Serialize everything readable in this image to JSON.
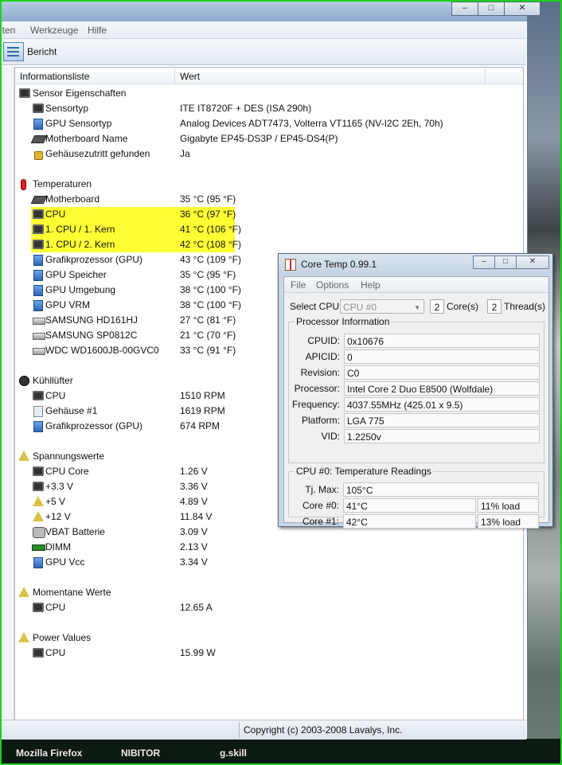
{
  "everest": {
    "menu": [
      "iten",
      "Werkzeuge",
      "Hilfe"
    ],
    "toolbar": {
      "report_label": "Bericht"
    },
    "columns": {
      "name": "Informationsliste",
      "value": "Wert"
    },
    "sections": {
      "sensor": "Sensor Eigenschaften",
      "temps": "Temperaturen",
      "fans": "Kühllüfter",
      "voltages": "Spannungswerte",
      "currents": "Momentane Werte",
      "power": "Power Values"
    },
    "rows": {
      "sensortyp": {
        "name": "Sensortyp",
        "value": "ITE IT8720F + DES  (ISA 290h)"
      },
      "gpu_sensortyp": {
        "name": "GPU Sensortyp",
        "value": "Analog Devices ADT7473, Volterra VT1165  (NV-I2C 2Eh, 70h)"
      },
      "mb_name": {
        "name": "Motherboard Name",
        "value": "Gigabyte EP45-DS3P / EP45-DS4(P)"
      },
      "intrusion": {
        "name": "Gehäusezutritt gefunden",
        "value": "Ja"
      },
      "t_mb": {
        "name": "Motherboard",
        "value": "35 °C  (95 °F)"
      },
      "t_cpu": {
        "name": "CPU",
        "value": "36 °C  (97 °F)"
      },
      "t_core1": {
        "name": "1. CPU / 1. Kern",
        "value": "41 °C  (106 °F)"
      },
      "t_core2": {
        "name": "1. CPU / 2. Kern",
        "value": "42 °C  (108 °F)"
      },
      "t_gpu": {
        "name": "Grafikprozessor (GPU)",
        "value": "43 °C  (109 °F)"
      },
      "t_gpumem": {
        "name": "GPU Speicher",
        "value": "35 °C  (95 °F)"
      },
      "t_gpuamb": {
        "name": "GPU Umgebung",
        "value": "38 °C  (100 °F)"
      },
      "t_gpuvrm": {
        "name": "GPU VRM",
        "value": "38 °C  (100 °F)"
      },
      "t_hd1": {
        "name": "SAMSUNG HD161HJ",
        "value": "27 °C  (81 °F)"
      },
      "t_hd2": {
        "name": "SAMSUNG SP0812C",
        "value": "21 °C  (70 °F)"
      },
      "t_hd3": {
        "name": "WDC WD1600JB-00GVC0",
        "value": "33 °C  (91 °F)"
      },
      "f_cpu": {
        "name": "CPU",
        "value": "1510 RPM"
      },
      "f_case": {
        "name": "Gehäuse #1",
        "value": "1619 RPM"
      },
      "f_gpu": {
        "name": "Grafikprozessor (GPU)",
        "value": "674 RPM"
      },
      "v_core": {
        "name": "CPU Core",
        "value": "1.26 V"
      },
      "v_33": {
        "name": "+3.3 V",
        "value": "3.36 V"
      },
      "v_5": {
        "name": "+5 V",
        "value": "4.89 V"
      },
      "v_12": {
        "name": "+12 V",
        "value": "11.84 V"
      },
      "v_bat": {
        "name": "VBAT Batterie",
        "value": "3.09 V"
      },
      "v_dimm": {
        "name": "DIMM",
        "value": "2.13 V"
      },
      "v_gpu": {
        "name": "GPU Vcc",
        "value": "3.34 V"
      },
      "c_cpu": {
        "name": "CPU",
        "value": "12.65 A"
      },
      "p_cpu": {
        "name": "CPU",
        "value": "15.99 W"
      }
    },
    "status": "Copyright (c) 2003-2008 Lavalys, Inc."
  },
  "coretemp": {
    "title": "Core Temp 0.99.1",
    "menu": [
      "File",
      "Options",
      "Help"
    ],
    "select_cpu_label": "Select CPU:",
    "select_cpu_value": "CPU #0",
    "cores": "2",
    "cores_label": "Core(s)",
    "threads": "2",
    "threads_label": "Thread(s)",
    "proc_group": "Processor Information",
    "info": [
      {
        "k": "CPUID:",
        "v": "0x10676"
      },
      {
        "k": "APICID:",
        "v": "0"
      },
      {
        "k": "Revision:",
        "v": "C0"
      },
      {
        "k": "Processor:",
        "v": "Intel Core 2 Duo E8500 (Wolfdale)"
      },
      {
        "k": "Frequency:",
        "v": "4037.55MHz (425.01 x 9.5)"
      },
      {
        "k": "Platform:",
        "v": "LGA 775"
      },
      {
        "k": "VID:",
        "v": "1.2250v"
      }
    ],
    "temp_group": "CPU #0: Temperature Readings",
    "tjmax_label": "Tj. Max:",
    "tjmax": "105°C",
    "core0_label": "Core #0:",
    "core0": "41°C",
    "core0_load": "11% load",
    "core1_label": "Core #1:",
    "core1": "42°C",
    "core1_load": "13% load"
  },
  "taskbar": [
    "Mozilla Firefox",
    "NIBITOR",
    "g.skill"
  ],
  "colors": {
    "highlight": "#ffff33",
    "frame": "#1bd21b"
  }
}
